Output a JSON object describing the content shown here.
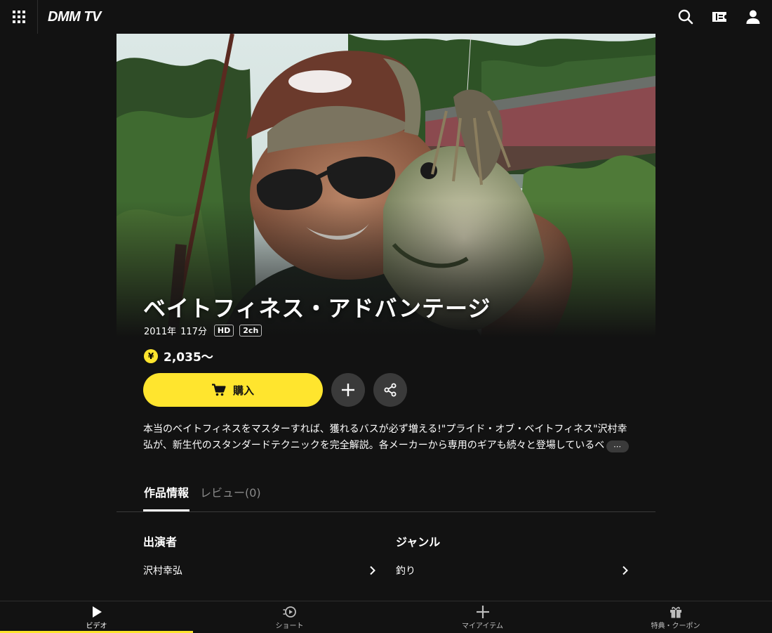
{
  "app": {
    "logo": "DMM TV"
  },
  "header": {
    "icons": [
      "grid-icon",
      "search-icon",
      "ticket-icon",
      "user-icon"
    ]
  },
  "hero": {
    "image": "man-holding-bass-photo"
  },
  "title": "ベイトフィネス・アドバンテージ",
  "meta": {
    "year": "2011年",
    "duration": "117分",
    "badges": [
      "HD",
      "2ch"
    ]
  },
  "price": {
    "currency_symbol": "¥",
    "value": "2,035〜"
  },
  "actions": {
    "buy_label": "購入"
  },
  "description": {
    "line1": "本当のベイトフィネスをマスターすれば、獲れるバスが必ず増える!\"プライド・オブ・ベイトフィネス\"沢村幸",
    "line2": "弘が、新生代のスタンダードテクニックを完全解説。各メーカーから専用のギアも続々と登場しているベ",
    "more": "⋯"
  },
  "tabs": [
    {
      "label": "作品情報",
      "active": true
    },
    {
      "label": "レビュー(0)",
      "active": false
    }
  ],
  "info": {
    "cast": {
      "heading": "出演者",
      "value": "沢村幸弘"
    },
    "genre": {
      "heading": "ジャンル",
      "value": "釣り"
    }
  },
  "bottom_nav": [
    {
      "label": "ビデオ",
      "icon": "play-icon",
      "active": true
    },
    {
      "label": "ショート",
      "icon": "short-play-icon",
      "active": false
    },
    {
      "label": "マイアイテム",
      "icon": "plus-icon",
      "active": false
    },
    {
      "label": "特典・クーポン",
      "icon": "gift-icon",
      "active": false
    }
  ],
  "colors": {
    "accent": "#ffe52e",
    "background": "#121212"
  }
}
